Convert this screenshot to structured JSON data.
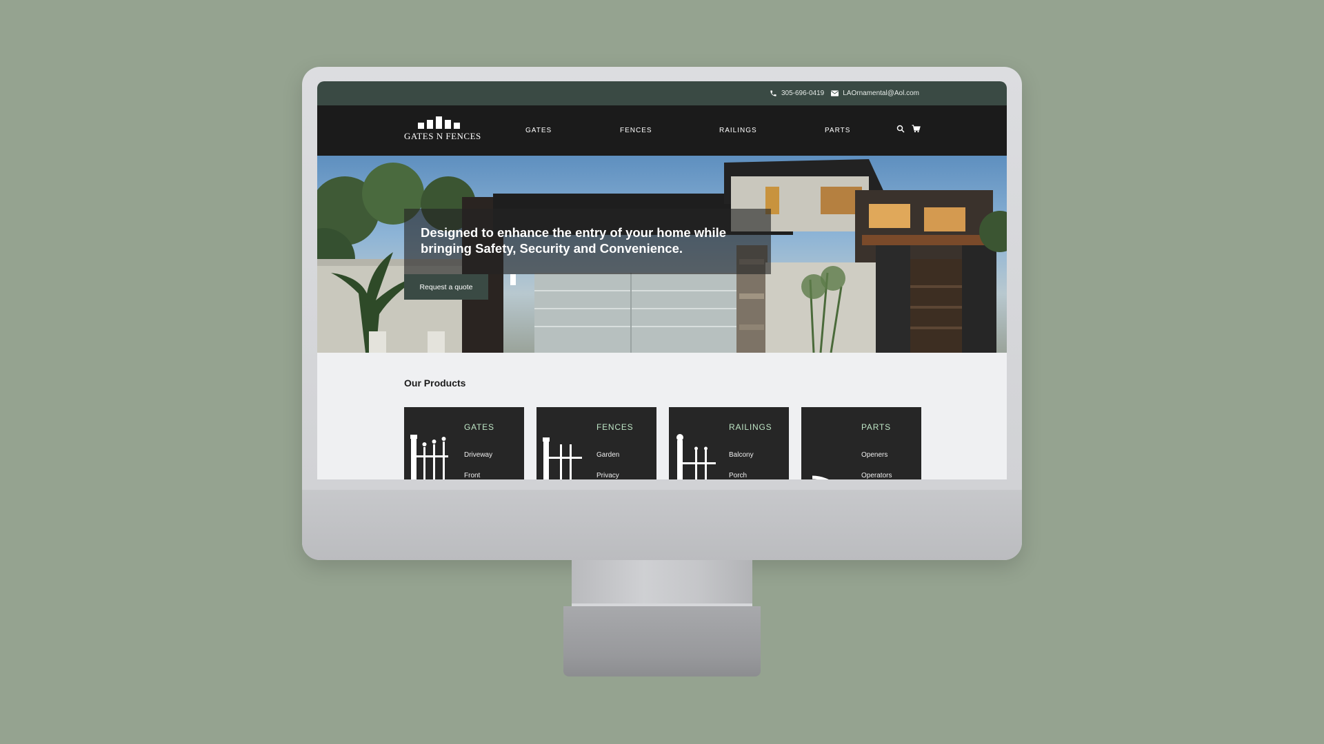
{
  "topbar": {
    "phone": "305-696-0419",
    "email": "LAOrnamental@Aol.com",
    "phone_icon": "phone-icon",
    "email_icon": "envelope-icon"
  },
  "logo": {
    "text": "GATES N FENCES"
  },
  "nav": {
    "items": [
      {
        "label": "GATES"
      },
      {
        "label": "FENCES"
      },
      {
        "label": "RAILINGS"
      },
      {
        "label": "PARTS"
      }
    ],
    "search_icon": "search-icon",
    "cart_icon": "cart-icon"
  },
  "hero": {
    "title": "Designed to enhance the entry of your home while bringing Safety, Security and Convenience.",
    "button_label": "Request a quote"
  },
  "products": {
    "heading": "Our Products",
    "cards": [
      {
        "title": "GATES",
        "items": [
          "Driveway",
          "Front"
        ]
      },
      {
        "title": "FENCES",
        "items": [
          "Garden",
          "Privacy"
        ]
      },
      {
        "title": "RAILINGS",
        "items": [
          "Balcony",
          "Porch"
        ]
      },
      {
        "title": "PARTS",
        "items": [
          "Openers",
          "Operators"
        ]
      }
    ]
  },
  "colors": {
    "background": "#95a390",
    "topbar": "#3a4a44",
    "navbar": "#1b1b1b",
    "card": "#262626",
    "card_title": "#bfe6c6"
  }
}
